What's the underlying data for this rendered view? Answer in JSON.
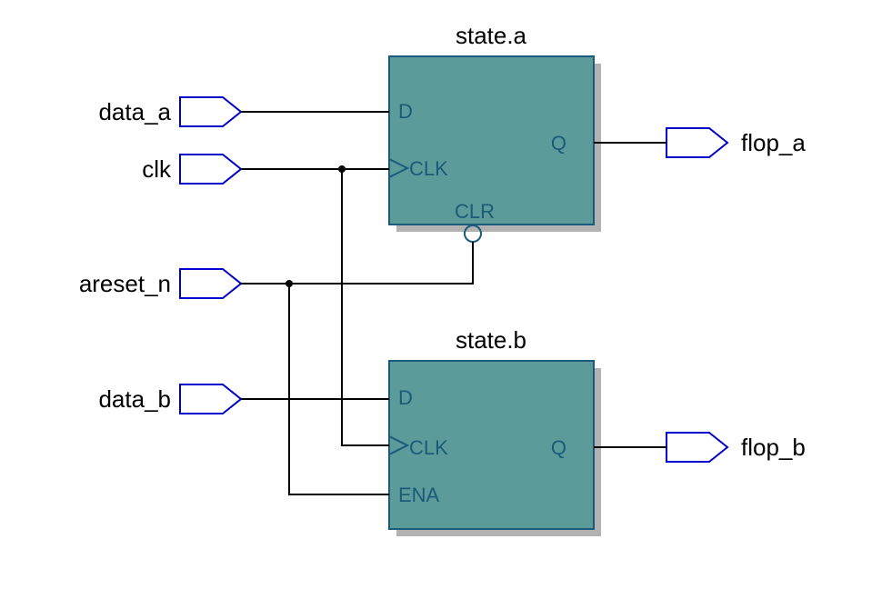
{
  "inputs": {
    "data_a": {
      "label": "data_a"
    },
    "clk": {
      "label": "clk"
    },
    "areset_n": {
      "label": "areset_n"
    },
    "data_b": {
      "label": "data_b"
    }
  },
  "outputs": {
    "flop_a": {
      "label": "flop_a"
    },
    "flop_b": {
      "label": "flop_b"
    }
  },
  "blocks": {
    "state_a": {
      "title": "state.a",
      "pins": {
        "d": "D",
        "clk": "CLK",
        "clr": "CLR",
        "q": "Q"
      }
    },
    "state_b": {
      "title": "state.b",
      "pins": {
        "d": "D",
        "clk": "CLK",
        "ena": "ENA",
        "q": "Q"
      }
    }
  }
}
